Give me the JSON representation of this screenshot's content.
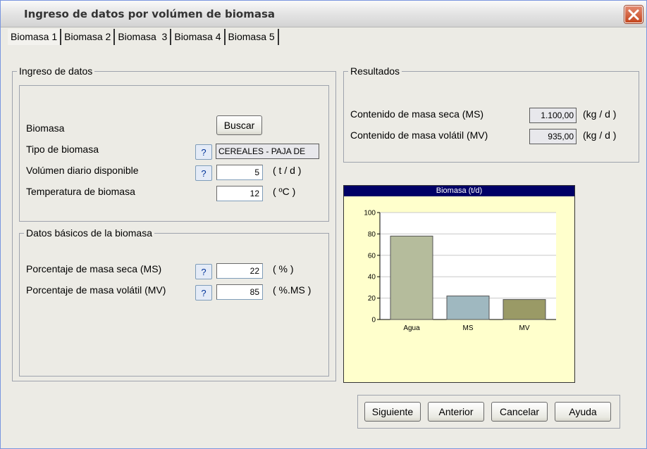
{
  "window": {
    "title": "Ingreso de datos por volúmen de biomasa"
  },
  "tabs": [
    {
      "label": "Biomasa 1",
      "active": true
    },
    {
      "label": "Biomasa 2",
      "active": false
    },
    {
      "label": "Biomasa  3",
      "active": false
    },
    {
      "label": "Biomasa 4",
      "active": false
    },
    {
      "label": "Biomasa 5",
      "active": false
    }
  ],
  "ingreso": {
    "legend": "Ingreso de datos",
    "biomasa_label": "Biomasa",
    "buscar_label": "Buscar",
    "tipo_label": "Tipo de biomasa",
    "tipo_value": "CEREALES - PAJA DE",
    "volumen_label": "Volúmen diario disponible",
    "volumen_value": "5",
    "volumen_unit": "( t / d )",
    "temp_label": "Temperatura de biomasa",
    "temp_value": "12",
    "temp_unit": "( ºC )",
    "help": "?"
  },
  "basicos": {
    "legend": "Datos básicos de la biomasa",
    "ms_label": "Porcentaje de masa seca (MS)",
    "ms_value": "22",
    "ms_unit": "( % )",
    "mv_label": "Porcentaje de masa volátil (MV)",
    "mv_value": "85",
    "mv_unit": "( %.MS )"
  },
  "resultados": {
    "legend": "Resultados",
    "ms_label": "Contenido de masa seca (MS)",
    "ms_value": "1.100,00",
    "ms_unit": "(kg / d )",
    "mv_label": "Contenido de masa volátil (MV)",
    "mv_value": "935,00",
    "mv_unit": "(kg / d )"
  },
  "buttons": {
    "siguiente": "Siguiente",
    "anterior": "Anterior",
    "cancelar": "Cancelar",
    "ayuda": "Ayuda"
  },
  "chart_data": {
    "type": "bar",
    "title": "Biomasa (t/d)",
    "categories": [
      "Agua",
      "MS",
      "MV"
    ],
    "values": [
      78,
      22,
      18.7
    ],
    "colors": [
      "#b5bc9c",
      "#9fb8c0",
      "#9a9a66"
    ],
    "ylim": [
      0,
      100
    ],
    "yticks": [
      "0",
      "20",
      "40",
      "60",
      "80",
      "100"
    ],
    "grid": true,
    "xlabel": "",
    "ylabel": ""
  }
}
